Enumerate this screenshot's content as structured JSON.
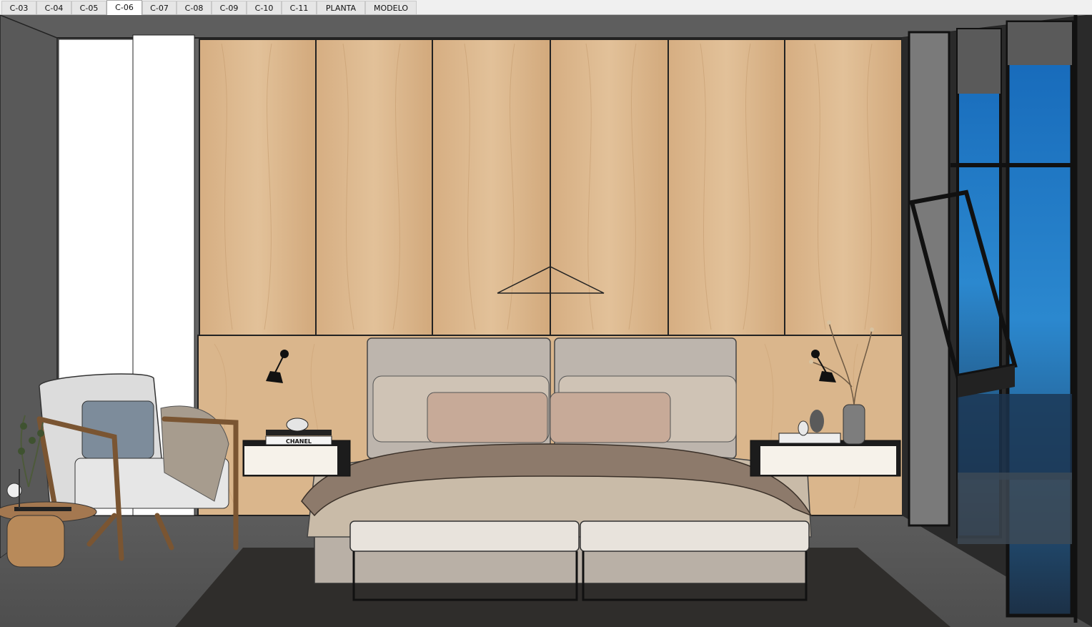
{
  "app": {
    "view": "SketchUp scene viewport"
  },
  "tabs": [
    {
      "label": "C-03",
      "active": false
    },
    {
      "label": "C-04",
      "active": false
    },
    {
      "label": "C-05",
      "active": false
    },
    {
      "label": "C-06",
      "active": true
    },
    {
      "label": "C-07",
      "active": false
    },
    {
      "label": "C-08",
      "active": false
    },
    {
      "label": "C-09",
      "active": false
    },
    {
      "label": "C-10",
      "active": false
    },
    {
      "label": "C-11",
      "active": false
    },
    {
      "label": "PLANTA",
      "active": false
    },
    {
      "label": "MODELO",
      "active": false
    }
  ],
  "scene": {
    "book_label": "CHANEL",
    "colors": {
      "wall": "#5f5f5f",
      "wood": "#d9b48a",
      "headboard": "#bdb5ad",
      "sheets": "#c8b9a6",
      "throw": "#8d7a6b",
      "rug": "#2e2c2a",
      "sky": "#1e73c0",
      "frame": "#1a1a1a"
    }
  }
}
